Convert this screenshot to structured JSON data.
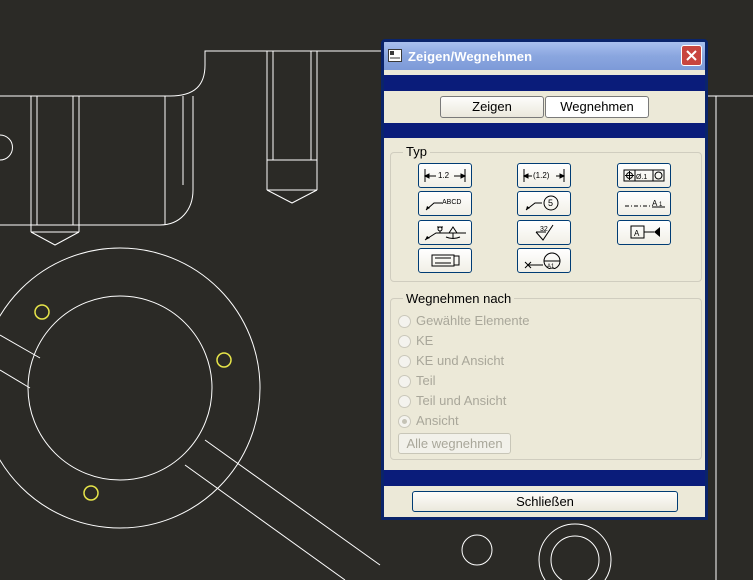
{
  "window": {
    "title": "Zeigen/Wegnehmen",
    "title_icon": "window-app-icon",
    "close_icon": "close-icon"
  },
  "tabs": {
    "show_label": "Zeigen",
    "remove_label": "Wegnehmen",
    "active": "Wegnehmen"
  },
  "type_group": {
    "legend": "Typ",
    "buttons": [
      {
        "name": "dimension",
        "icon": "dimension-icon",
        "text": "1.2"
      },
      {
        "name": "reference-dimension",
        "icon": "reference-dimension-icon",
        "text": "(1.2)"
      },
      {
        "name": "geometric-tolerance",
        "icon": "geometric-tolerance-icon",
        "text": "Ø.1"
      },
      {
        "name": "note",
        "icon": "note-icon",
        "text": "ABCD"
      },
      {
        "name": "balloon",
        "icon": "balloon-icon",
        "text": "5"
      },
      {
        "name": "axis",
        "icon": "axis-icon",
        "text": "A_1"
      },
      {
        "name": "weld-symbol",
        "icon": "weld-symbol-icon",
        "text": ""
      },
      {
        "name": "surface-finish",
        "icon": "surface-finish-icon",
        "text": "32"
      },
      {
        "name": "datum",
        "icon": "datum-icon",
        "text": "A"
      },
      {
        "name": "cosmetic-feature",
        "icon": "cosmetic-feature-icon",
        "text": ""
      },
      {
        "name": "datum-target",
        "icon": "datum-target-icon",
        "text": "A1"
      }
    ]
  },
  "remove_group": {
    "legend": "Wegnehmen nach",
    "options": [
      {
        "label": "Gewählte Elemente",
        "selected": false
      },
      {
        "label": "KE",
        "selected": false
      },
      {
        "label": "KE und Ansicht",
        "selected": false
      },
      {
        "label": "Teil",
        "selected": false
      },
      {
        "label": "Teil und Ansicht",
        "selected": false
      },
      {
        "label": "Ansicht",
        "selected": true
      }
    ],
    "remove_all_label": "Alle wegnehmen",
    "disabled": true
  },
  "footer": {
    "close_label": "Schließen"
  },
  "colors": {
    "background": "#2b2a26",
    "drawing_lines": "#ffffff",
    "highlight": "#e8e64a",
    "dialog_face": "#ece9d8",
    "dark_bar": "#0a1c7a"
  }
}
